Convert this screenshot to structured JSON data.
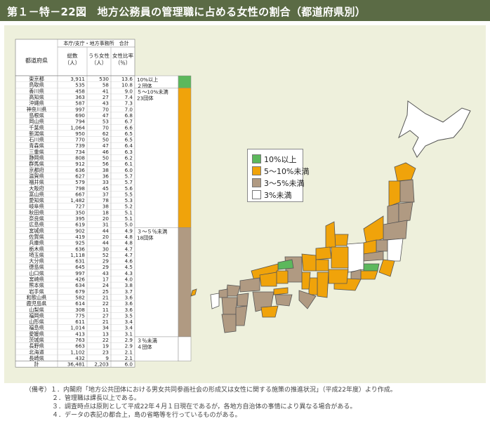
{
  "title": "第１－特－22図　地方公務員の管理職に占める女性の割合（都道府県別）",
  "colors": {
    "header_bg": "#5b6b45",
    "panel_bg": "#eef0dc",
    "green": "#5cb85c",
    "orange": "#f0a30a",
    "taupe": "#b09a82",
    "white": "#ffffff",
    "map_land": "#ffffff"
  },
  "table": {
    "col_pref": "都道府県",
    "col_group": "本庁/支庁・地方事務所　合計",
    "col_total": "総数（人）",
    "col_women": "うち女性（人）",
    "col_ratio": "女性比率（％）",
    "total_row": {
      "label": "計",
      "total": "36,481",
      "women": "2,203",
      "ratio": "6.0"
    }
  },
  "chart_data": {
    "type": "table",
    "columns": [
      "都道府県",
      "総数（人）",
      "うち女性（人）",
      "女性比率（％）"
    ],
    "rows": [
      [
        "東京都",
        "3,911",
        "530",
        "13.6"
      ],
      [
        "鳥取県",
        "535",
        "58",
        "10.8"
      ],
      [
        "香川県",
        "458",
        "41",
        "9.0"
      ],
      [
        "高知県",
        "363",
        "27",
        "7.4"
      ],
      [
        "沖縄県",
        "587",
        "43",
        "7.3"
      ],
      [
        "神奈川県",
        "997",
        "70",
        "7.0"
      ],
      [
        "島根県",
        "690",
        "47",
        "6.8"
      ],
      [
        "岡山県",
        "794",
        "53",
        "6.7"
      ],
      [
        "千葉県",
        "1,064",
        "70",
        "6.6"
      ],
      [
        "新潟県",
        "950",
        "62",
        "6.5"
      ],
      [
        "石川県",
        "770",
        "50",
        "6.5"
      ],
      [
        "青森県",
        "739",
        "47",
        "6.4"
      ],
      [
        "三重県",
        "734",
        "46",
        "6.3"
      ],
      [
        "静岡県",
        "808",
        "50",
        "6.2"
      ],
      [
        "群馬県",
        "912",
        "56",
        "6.1"
      ],
      [
        "京都府",
        "636",
        "38",
        "6.0"
      ],
      [
        "滋賀県",
        "627",
        "36",
        "5.7"
      ],
      [
        "福井県",
        "579",
        "33",
        "5.7"
      ],
      [
        "大阪府",
        "798",
        "45",
        "5.6"
      ],
      [
        "富山県",
        "667",
        "37",
        "5.5"
      ],
      [
        "愛知県",
        "1,482",
        "78",
        "5.3"
      ],
      [
        "岐阜県",
        "727",
        "38",
        "5.2"
      ],
      [
        "秋田県",
        "350",
        "18",
        "5.1"
      ],
      [
        "奈良県",
        "395",
        "20",
        "5.1"
      ],
      [
        "広島県",
        "619",
        "31",
        "5.0"
      ],
      [
        "宮城県",
        "902",
        "44",
        "4.9"
      ],
      [
        "佐賀県",
        "419",
        "20",
        "4.8"
      ],
      [
        "兵庫県",
        "925",
        "44",
        "4.8"
      ],
      [
        "栃木県",
        "636",
        "30",
        "4.7"
      ],
      [
        "埼玉県",
        "1,118",
        "52",
        "4.7"
      ],
      [
        "大分県",
        "631",
        "29",
        "4.6"
      ],
      [
        "徳島県",
        "645",
        "29",
        "4.5"
      ],
      [
        "山口県",
        "997",
        "43",
        "4.3"
      ],
      [
        "宮崎県",
        "426",
        "17",
        "4.0"
      ],
      [
        "熊本県",
        "634",
        "24",
        "3.8"
      ],
      [
        "岩手県",
        "679",
        "25",
        "3.7"
      ],
      [
        "和歌山県",
        "582",
        "21",
        "3.6"
      ],
      [
        "鹿児島県",
        "614",
        "22",
        "3.6"
      ],
      [
        "山梨県",
        "308",
        "11",
        "3.6"
      ],
      [
        "福岡県",
        "775",
        "27",
        "3.5"
      ],
      [
        "山形県",
        "611",
        "21",
        "3.4"
      ],
      [
        "福島県",
        "1,014",
        "34",
        "3.4"
      ],
      [
        "愛媛県",
        "413",
        "13",
        "3.1"
      ],
      [
        "茨城県",
        "763",
        "22",
        "2.9"
      ],
      [
        "長野県",
        "663",
        "19",
        "2.9"
      ],
      [
        "北海道",
        "1,102",
        "23",
        "2.1"
      ],
      [
        "長崎県",
        "432",
        "9",
        "2.1"
      ]
    ]
  },
  "bands": [
    {
      "note1": "10%以上",
      "note2": "２団体",
      "color": "green",
      "count": 2
    },
    {
      "note1": "５～10%未満",
      "note2": "23団体",
      "color": "orange",
      "count": 23
    },
    {
      "note1": "３～５％未満",
      "note2": "18団体",
      "color": "taupe",
      "count": 18
    },
    {
      "note1": "３％未満",
      "note2": "４団体",
      "color": "white",
      "count": 4
    }
  ],
  "legend": [
    {
      "label": "10%以上",
      "color": "green"
    },
    {
      "label": "5～10%未満",
      "color": "orange"
    },
    {
      "label": "3～5%未満",
      "color": "taupe"
    },
    {
      "label": "3%未満",
      "color": "white"
    }
  ],
  "notes": [
    "（備考）１．内閣府「地方公共団体における男女共同参画社会の形成又は女性に関する施策の推進状況」（平成22年度）より作成。",
    "２．管理職は課長以上である。",
    "３．調査時点は原則として平成22年４月１日現在であるが，各地方自治体の事情により異なる場合がある。",
    "４．データの表記の都合上，島の省略等を行っているものがある。"
  ]
}
